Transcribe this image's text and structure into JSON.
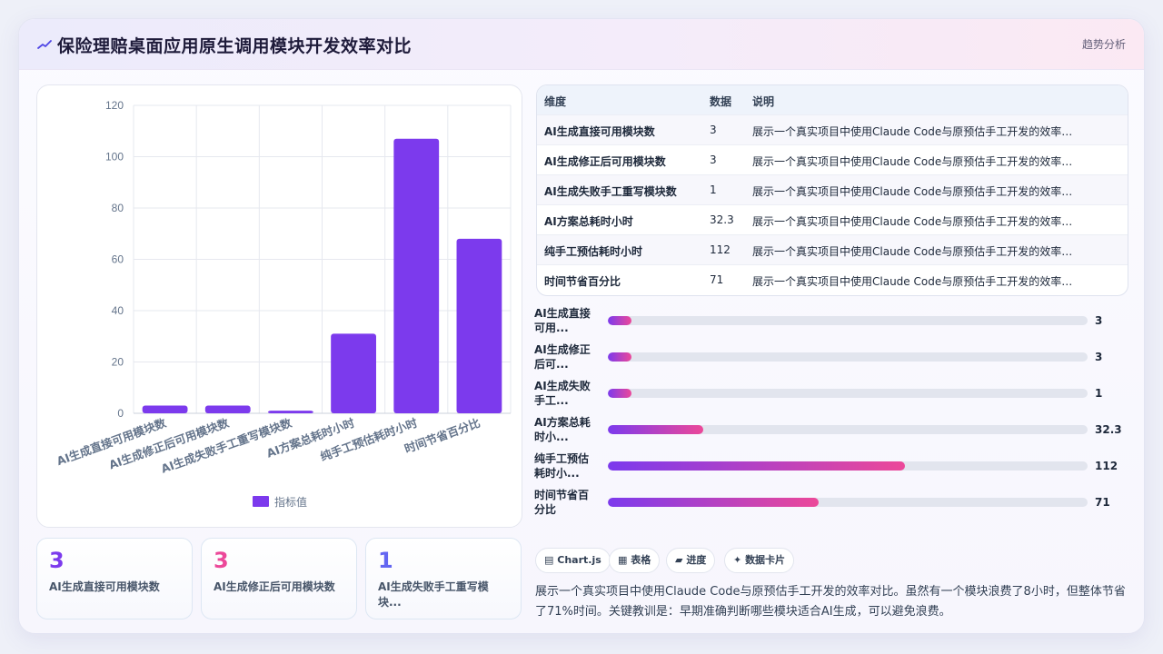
{
  "header": {
    "title": "保险理赔桌面应用原生调用模块开发效率对比",
    "badge": "趋势分析"
  },
  "chart_data": {
    "type": "bar",
    "categories": [
      "AI生成直接可用模块数",
      "AI生成修正后可用模块数",
      "AI生成失败手工重写模块数",
      "AI方案总耗时小时",
      "纯手工预估耗时小时",
      "时间节省百分比"
    ],
    "series": [
      {
        "name": "指标值",
        "values": [
          3,
          3,
          1,
          31,
          107,
          68
        ]
      }
    ],
    "ylim": [
      0,
      120
    ],
    "yticks": [
      0,
      20,
      40,
      60,
      80,
      100,
      120
    ],
    "legend": "bottom",
    "grid": true,
    "color": "#7c3aed"
  },
  "table": {
    "headers": [
      "维度",
      "数据",
      "说明"
    ],
    "rows": [
      [
        "AI生成直接可用模块数",
        "3",
        "展示一个真实项目中使用Claude Code与原预估手工开发的效率对..."
      ],
      [
        "AI生成修正后可用模块数",
        "3",
        "展示一个真实项目中使用Claude Code与原预估手工开发的效率对..."
      ],
      [
        "AI生成失败手工重写模块数",
        "1",
        "展示一个真实项目中使用Claude Code与原预估手工开发的效率对..."
      ],
      [
        "AI方案总耗时小时",
        "32.3",
        "展示一个真实项目中使用Claude Code与原预估手工开发的效率对..."
      ],
      [
        "纯手工预估耗时小时",
        "112",
        "展示一个真实项目中使用Claude Code与原预估手工开发的效率对..."
      ],
      [
        "时间节省百分比",
        "71",
        "展示一个真实项目中使用Claude Code与原预估手工开发的效率对..."
      ]
    ]
  },
  "progress": [
    {
      "label": "AI生成直接可用...",
      "value": "3",
      "fraction": 0.05
    },
    {
      "label": "AI生成修正后可...",
      "value": "3",
      "fraction": 0.05
    },
    {
      "label": "AI生成失败手工...",
      "value": "1",
      "fraction": 0.05
    },
    {
      "label": "AI方案总耗时小...",
      "value": "32.3",
      "fraction": 0.198
    },
    {
      "label": "纯手工预估耗时小...",
      "value": "112",
      "fraction": 0.62
    },
    {
      "label": "时间节省百分比",
      "value": "71",
      "fraction": 0.44
    }
  ],
  "stats": [
    {
      "num": "3",
      "label": "AI生成直接可用模块数",
      "color": "#7c3aed"
    },
    {
      "num": "3",
      "label": "AI生成修正后可用模块数",
      "color": "#ec4899"
    },
    {
      "num": "1",
      "label": "AI生成失败手工重写模块...",
      "color": "#6366f1"
    }
  ],
  "chips": [
    {
      "icon": "▤",
      "label": "Chart.js"
    },
    {
      "icon": "▦",
      "label": "表格"
    },
    {
      "icon": "▰",
      "label": "进度"
    },
    {
      "icon": "✦",
      "label": "数据卡片"
    }
  ],
  "summary": "展示一个真实项目中使用Claude Code与原预估手工开发的效率对比。虽然有一个模块浪费了8小时，但整体节省了71%时间。关键教训是：早期准确判断哪些模块适合AI生成，可以避免浪费。"
}
